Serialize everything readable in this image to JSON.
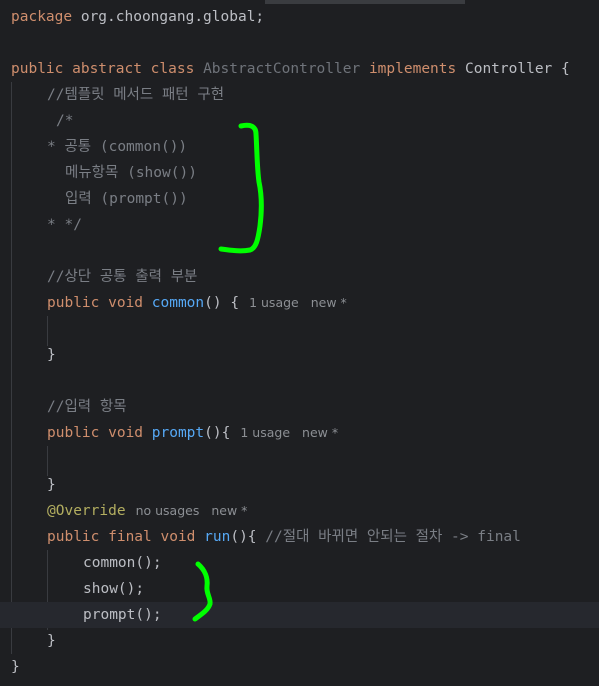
{
  "colors": {
    "background": "#1e1f22",
    "keyword": "#cf8e6d",
    "comment": "#7a7e85",
    "method": "#56a8f5",
    "annotation": "#b3ae60",
    "marker": "#00ff00"
  },
  "code": {
    "package_kw": "package",
    "package_name": " org.choongang.global;",
    "class_kw": "public abstract class",
    "class_name": "AbstractController",
    "implements_kw": "implements",
    "interface_name": " Controller {",
    "comment_template": "//템플릿 메서드 패턴 구현",
    "block_open": "/*",
    "block_common": "* 공통 (common())",
    "block_show": "메뉴항목 (show())",
    "block_prompt": "입력 (prompt())",
    "block_close": "* */",
    "comment_header": "//상단 공통 출력 부분",
    "public_void": "public void",
    "common_name": "common",
    "common_sig": "() {",
    "common_usage": "1 usage",
    "common_new": "new *",
    "brace": "}",
    "comment_input": "//입력 항목",
    "prompt_name": "prompt",
    "prompt_sig": "(){",
    "prompt_usage": "1 usage",
    "prompt_new": "new *",
    "override": "@Override",
    "override_usage": "no usages",
    "override_new": "new *",
    "public_final_void": "public final void",
    "run_name": "run",
    "run_sig": "(){",
    "run_comment": "//절대 바뀌면 안되는 절차 -> final",
    "call_common": "common();",
    "call_show": "show();",
    "call_prompt": "prompt();",
    "close_method": "}",
    "close_class": "}"
  }
}
